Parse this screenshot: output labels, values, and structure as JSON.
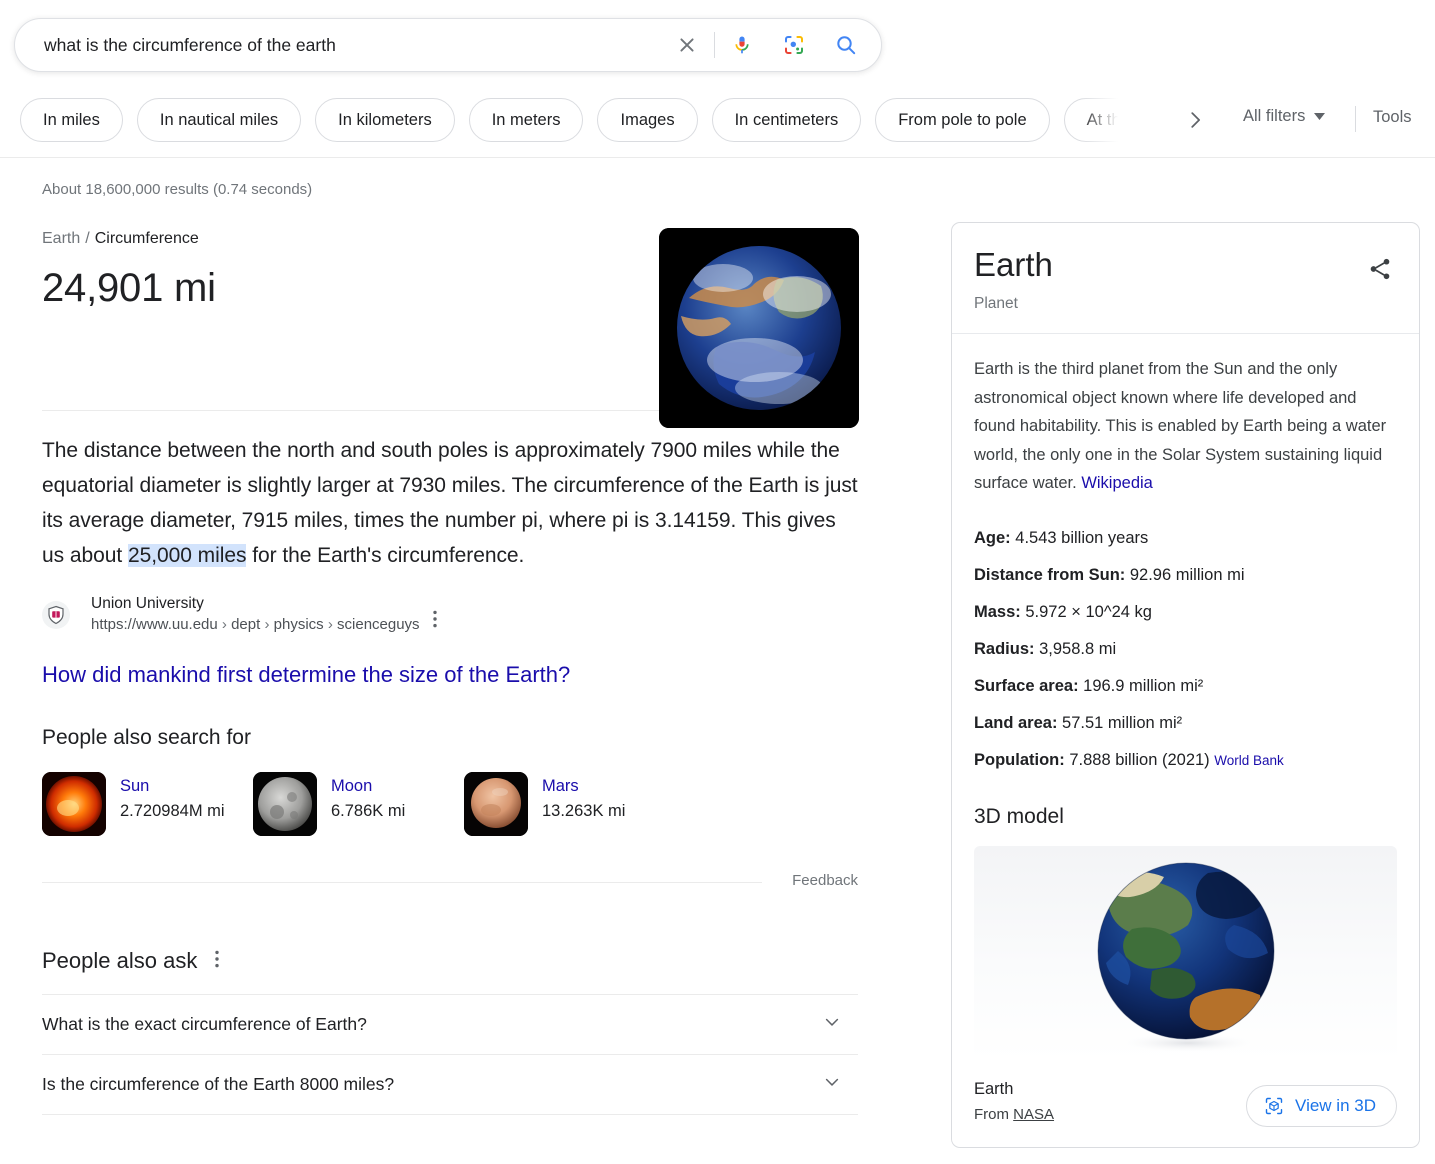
{
  "search": {
    "query": "what is the circumference of the earth",
    "placeholder": "Search",
    "clear_icon": "close-icon",
    "mic_icon": "microphone-icon",
    "lens_icon": "google-lens-icon",
    "search_icon": "search-icon"
  },
  "chips": [
    {
      "label": "In miles"
    },
    {
      "label": "In nautical miles"
    },
    {
      "label": "In kilometers"
    },
    {
      "label": "In meters"
    },
    {
      "label": "Images"
    },
    {
      "label": "In centimeters"
    },
    {
      "label": "From pole to pole"
    },
    {
      "label": "At the equator"
    }
  ],
  "toolbar": {
    "next_icon": "chevron-right-icon",
    "all_filters": "All filters",
    "all_filters_caret": "caret-down-icon",
    "tools": "Tools"
  },
  "result_stats": "About 18,600,000 results (0.74 seconds)",
  "featured": {
    "breadcrumb_entity": "Earth",
    "breadcrumb_sep": "/",
    "breadcrumb_attr": "Circumference",
    "answer": "24,901 mi",
    "snippet_part_1": "The distance between the north and south poles is approximately 7900 miles while the equatorial diameter is slightly larger at 7930 miles. The circumference of the Earth is just its average diameter, 7915 miles, times the number pi, where pi is 3.14159. This gives us about ",
    "snippet_highlight": "25,000 miles",
    "snippet_part_2": " for the Earth's circumference.",
    "source_name": "Union University",
    "source_url": "https://www.uu.edu",
    "source_path_1": "dept",
    "source_path_2": "physics",
    "source_path_3": "scienceguys",
    "kebab_icon": "more-options-icon",
    "related_link": "How did mankind first determine the size of the Earth?"
  },
  "pasf": {
    "title": "People also search for",
    "items": [
      {
        "name": "Sun",
        "value": "2.720984M mi",
        "thumb": "sun-thumbnail"
      },
      {
        "name": "Moon",
        "value": "6.786K mi",
        "thumb": "moon-thumbnail"
      },
      {
        "name": "Mars",
        "value": "13.263K mi",
        "thumb": "mars-thumbnail"
      }
    ],
    "feedback": "Feedback"
  },
  "paa": {
    "title": "People also ask",
    "kebab_icon": "more-options-icon",
    "questions": [
      {
        "q": "What is the exact circumference of Earth?"
      },
      {
        "q": "Is the circumference of the Earth 8000 miles?"
      }
    ],
    "chevron_icon": "chevron-down-icon"
  },
  "knowledge_panel": {
    "title": "Earth",
    "subtitle": "Planet",
    "share_icon": "share-icon",
    "description": "Earth is the third planet from the Sun and the only astronomical object known where life developed and found habitability. This is enabled by Earth being a water world, the only one in the Solar System sustaining liquid surface water. ",
    "description_link": "Wikipedia",
    "facts": [
      {
        "label": "Age:",
        "value": "4.543 billion years"
      },
      {
        "label": "Distance from Sun:",
        "value": "92.96 million mi"
      },
      {
        "label": "Mass:",
        "value": "5.972 × 10^24 kg"
      },
      {
        "label": "Radius:",
        "value": "3,958.8 mi"
      },
      {
        "label": "Surface area:",
        "value": "196.9 million mi²"
      },
      {
        "label": "Land area:",
        "value": "57.51 million mi²"
      },
      {
        "label": "Population:",
        "value": "7.888 billion (2021)",
        "source": "World Bank"
      }
    ],
    "model_3d": {
      "section_title": "3D model",
      "label": "Earth",
      "from_prefix": "From ",
      "from_source": "NASA",
      "view_button": "View in 3D",
      "view_icon": "ar-cube-icon"
    }
  },
  "colors": {
    "link_blue": "#1a0dab",
    "accent_blue": "#1a73e8",
    "highlight": "#d2e3fc",
    "muted_text": "#70757a",
    "border": "#dadce0"
  }
}
